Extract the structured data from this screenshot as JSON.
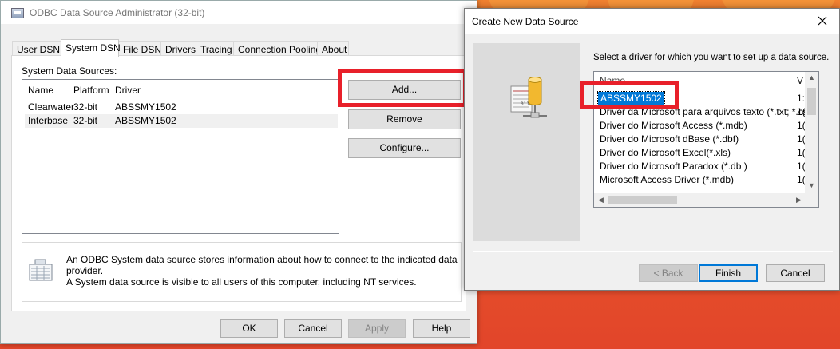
{
  "admin_dialog": {
    "title": "ODBC Data Source Administrator (32-bit)",
    "tabs": [
      "User DSN",
      "System DSN",
      "File DSN",
      "Drivers",
      "Tracing",
      "Connection Pooling",
      "About"
    ],
    "active_tab": "System DSN",
    "sources_label": "System Data Sources:",
    "columns": [
      "Name",
      "Platform",
      "Driver"
    ],
    "rows": [
      {
        "name": "Clearwater",
        "platform": "32-bit",
        "driver": "ABSSMY1502"
      },
      {
        "name": "Interbase",
        "platform": "32-bit",
        "driver": "ABSSMY1502"
      }
    ],
    "buttons": {
      "add": "Add...",
      "remove": "Remove",
      "configure": "Configure..."
    },
    "info_text_line1": "An ODBC System data source stores information about how to connect to the indicated data provider.",
    "info_text_line2": "A System data source is visible to all users of this computer, including NT services.",
    "footer_buttons": {
      "ok": "OK",
      "cancel": "Cancel",
      "apply": "Apply",
      "help": "Help"
    }
  },
  "create_dialog": {
    "title": "Create New Data Source",
    "prompt": "Select a driver for which you want to set up a data source.",
    "list_headers": {
      "name": "Name",
      "version": "V"
    },
    "selected_driver": "ABSSMY1502",
    "drivers": [
      {
        "name": "Driver da Microsoft para arquivos texto (*.txt; *.csv)",
        "version": "1("
      },
      {
        "name": "Driver do Microsoft Access (*.mdb)",
        "version": "1("
      },
      {
        "name": "Driver do Microsoft dBase (*.dbf)",
        "version": "1("
      },
      {
        "name": "Driver do Microsoft Excel(*.xls)",
        "version": "1("
      },
      {
        "name": "Driver do Microsoft Paradox (*.db )",
        "version": "1("
      },
      {
        "name": "Microsoft Access Driver (*.mdb)",
        "version": "1("
      }
    ],
    "selected_version": "1:",
    "buttons": {
      "back": "< Back",
      "finish": "Finish",
      "cancel": "Cancel"
    }
  },
  "colors": {
    "highlight_red": "#e8202a",
    "selection_blue": "#0078d7"
  }
}
